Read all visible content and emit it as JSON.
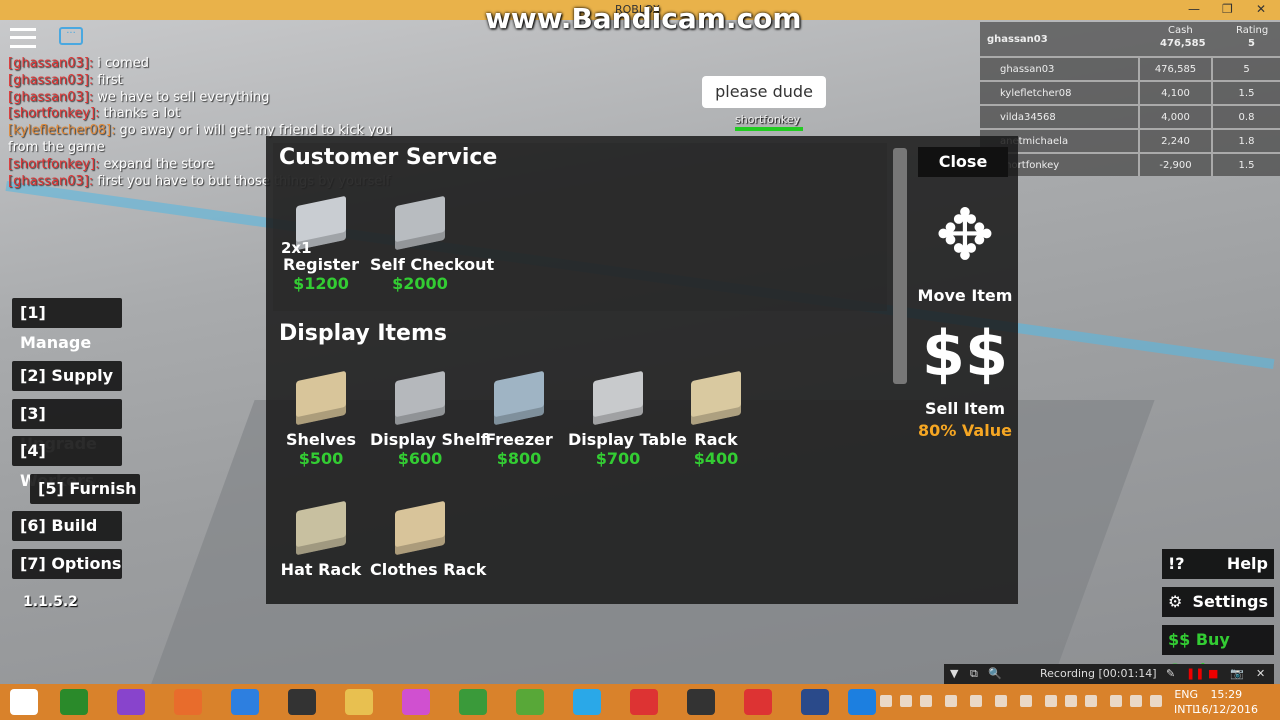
{
  "window": {
    "title": "ROBLOX",
    "watermark": "www.Bandicam.com"
  },
  "chat": [
    {
      "name": "[ghassan03]:",
      "msg": "i comed",
      "color": "#d33"
    },
    {
      "name": "[ghassan03]:",
      "msg": "first",
      "color": "#d33"
    },
    {
      "name": "[ghassan03]:",
      "msg": "we have to sell everything",
      "color": "#d33"
    },
    {
      "name": "[shortfonkey]:",
      "msg": "thanks a lot",
      "color": "#d33"
    },
    {
      "name": "[kylefletcher08]:",
      "msg": "go away or i will get my friend to kick you from the game",
      "color": "#e08a3a"
    },
    {
      "name": "[shortfonkey]:",
      "msg": "expand the store",
      "color": "#d33"
    },
    {
      "name": "[ghassan03]:",
      "msg": "first you have to but those things by yourself",
      "color": "#d33"
    }
  ],
  "leaderboard": {
    "player": "ghassan03",
    "cash_label": "Cash",
    "cash": "476,585",
    "rating_label": "Rating",
    "rating": "5",
    "rows": [
      {
        "name": "ghassan03",
        "cash": "476,585",
        "rating": "5"
      },
      {
        "name": "kylefletcher08",
        "cash": "4,100",
        "rating": "1.5"
      },
      {
        "name": "vilda34568",
        "cash": "4,000",
        "rating": "0.8"
      },
      {
        "name": "anetmichaela",
        "cash": "2,240",
        "rating": "1.8"
      },
      {
        "name": "shortfonkey",
        "cash": "-2,900",
        "rating": "1.5"
      }
    ]
  },
  "speech": {
    "text": "please dude",
    "name": "shortfonkey"
  },
  "menu": [
    "[1] Manage",
    "[2] Supply",
    "[3] Upgrade",
    "[4] Workers",
    "[5] Furnish",
    "[6] Build",
    "[7] Options"
  ],
  "version": "1.1.5.2",
  "shop": {
    "sections": [
      {
        "title": "Customer Service",
        "items": [
          {
            "name": "Register",
            "price": "$1200",
            "tag": "2x1"
          },
          {
            "name": "Self Checkout",
            "price": "$2000"
          }
        ]
      },
      {
        "title": "Display Items",
        "items": [
          {
            "name": "Shelves",
            "price": "$500"
          },
          {
            "name": "Display Shelf",
            "price": "$600"
          },
          {
            "name": "Freezer",
            "price": "$800"
          },
          {
            "name": "Display Table",
            "price": "$700"
          },
          {
            "name": "Rack",
            "price": "$400"
          },
          {
            "name": "Hat Rack",
            "price": ""
          },
          {
            "name": "Clothes Rack",
            "price": ""
          }
        ]
      }
    ],
    "close": "Close",
    "move": "Move Item",
    "sell_icon": "$$",
    "sell": "Sell Item",
    "sell_value": "80% Value"
  },
  "help": {
    "icon": "!?",
    "label": "Help"
  },
  "settings": {
    "label": "Settings"
  },
  "buycash": {
    "label": "$$ Buy Cash"
  },
  "recording": {
    "text": "Recording [00:01:14]"
  },
  "taskbar": {
    "lang1": "ENG",
    "lang2": "INTL",
    "time": "15:29",
    "date": "16/12/2016"
  },
  "colors": {
    "price": "#33cc33",
    "panel": "#191919",
    "taskbar": "#d9822b"
  }
}
